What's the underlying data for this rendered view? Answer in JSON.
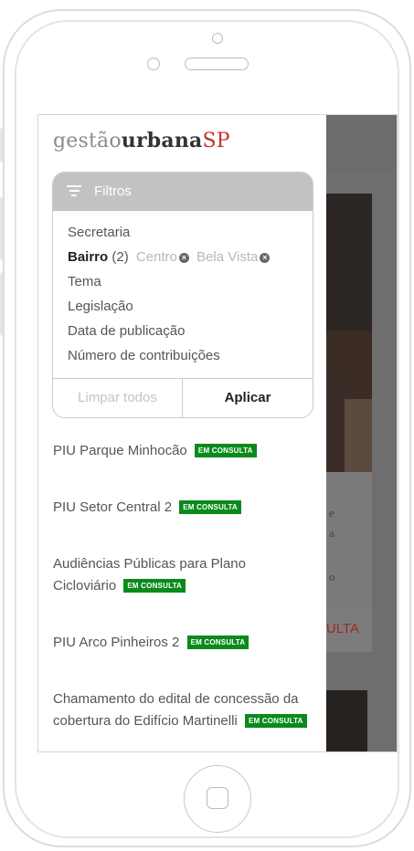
{
  "app": {
    "logo": {
      "part1": "gestão",
      "part2": "urbana",
      "part3": "SP"
    }
  },
  "filters": {
    "title": "Filtros",
    "items": [
      {
        "label": "Secretaria"
      },
      {
        "label": "Bairro",
        "count": "(2)",
        "chips": [
          "Centro",
          "Bela Vista"
        ]
      },
      {
        "label": "Tema"
      },
      {
        "label": "Legislação"
      },
      {
        "label": "Data de publicação"
      },
      {
        "label": "Número de contribuições"
      }
    ],
    "clear_label": "Limpar todos",
    "apply_label": "Aplicar"
  },
  "results": {
    "badge_label": "EM CONSULTA",
    "items": [
      {
        "title": "PIU Parque Minhocão"
      },
      {
        "title": "PIU Setor Central 2"
      },
      {
        "title": "Audiências Públicas para Plano Cicloviário"
      },
      {
        "title": "PIU Arco Pinheiros 2"
      },
      {
        "title": "Chamamento do edital de concessão da cobertura do Edifício Martinelli"
      }
    ]
  },
  "background": {
    "text_lines": [
      "e",
      "a",
      "o"
    ],
    "cta_fragment": "ULTA"
  },
  "colors": {
    "brand_red": "#c0332b",
    "badge_green": "#0b8a1c",
    "filter_header": "#c2c2c2"
  }
}
